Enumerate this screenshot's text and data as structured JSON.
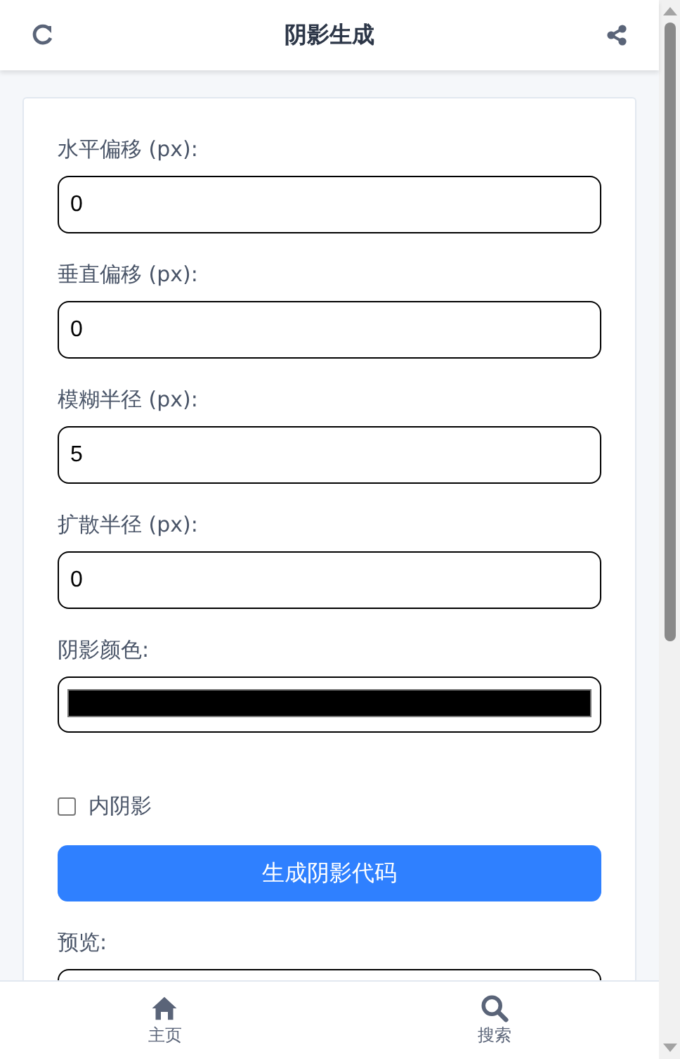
{
  "header": {
    "title": "阴影生成"
  },
  "fields": [
    {
      "kind": "number",
      "label": "水平偏移 (px):",
      "value": "0"
    },
    {
      "kind": "number",
      "label": "垂直偏移 (px):",
      "value": "0"
    },
    {
      "kind": "number",
      "label": "模糊半径 (px):",
      "value": "5"
    },
    {
      "kind": "number",
      "label": "扩散半径 (px):",
      "value": "0"
    },
    {
      "kind": "color",
      "label": "阴影颜色:",
      "color": "#000000"
    }
  ],
  "inset": {
    "label": "内阴影",
    "checked": false
  },
  "generate_button": "生成阴影代码",
  "preview": {
    "label": "预览:"
  },
  "nav": [
    {
      "kind": "home",
      "label": "主页"
    },
    {
      "kind": "search",
      "label": "搜索"
    }
  ]
}
